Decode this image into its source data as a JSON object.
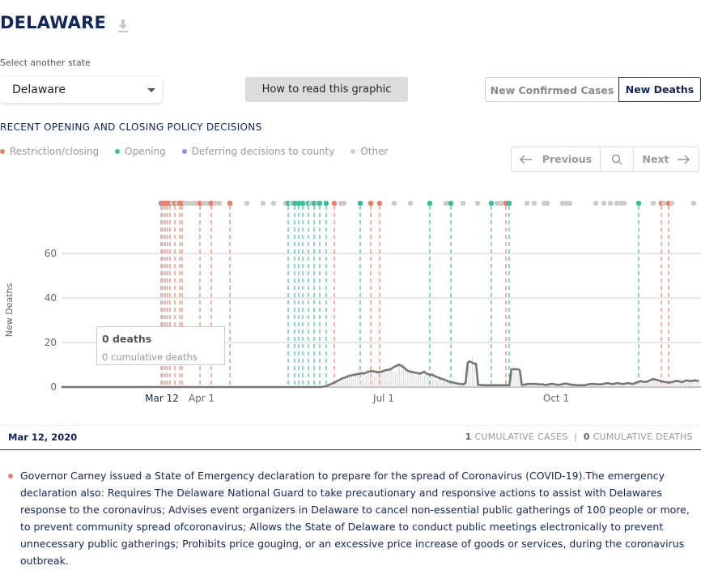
{
  "header": {
    "title": "DELAWARE",
    "download_icon": "download-icon"
  },
  "state_select": {
    "label": "Select another state",
    "value": "Delaware"
  },
  "how_to_button": "How to read this graphic",
  "metric_toggle": {
    "options": [
      "New Confirmed Cases",
      "New Deaths"
    ],
    "selected": "New Deaths"
  },
  "policy_section": {
    "title": "RECENT OPENING AND CLOSING POLICY DECISIONS",
    "legend": [
      {
        "label": "Restriction/closing",
        "color": "#e8806c"
      },
      {
        "label": "Opening",
        "color": "#3cbf9a"
      },
      {
        "label": "Deferring decisions to county",
        "color": "#8b93e8"
      },
      {
        "label": "Other",
        "color": "#cccccc"
      }
    ]
  },
  "nav": {
    "previous": "Previous",
    "next": "Next"
  },
  "chart_data": {
    "type": "bar",
    "ylabel": "New Deaths",
    "y_ticks": [
      "0",
      "20",
      "40",
      "60"
    ],
    "ylim": [
      0,
      75
    ],
    "x_ticks": [
      "Mar 12",
      "Apr 1",
      "Jul 1",
      "Oct 1"
    ],
    "highlight_tick": "Mar 12",
    "series": [
      {
        "type": "moving_average_line",
        "values": [
          0,
          0,
          0,
          0,
          0,
          0,
          0,
          0,
          0,
          0,
          0,
          0,
          0,
          0,
          0,
          0,
          0,
          0,
          0,
          0,
          0,
          0,
          0,
          0,
          0,
          0,
          0,
          0,
          0,
          0,
          0,
          0,
          0,
          0,
          0,
          0,
          0,
          0,
          0,
          0,
          0,
          0,
          0,
          0,
          0,
          0,
          0,
          0,
          0,
          0,
          0,
          0,
          0,
          0,
          0,
          0,
          0,
          0,
          0,
          0,
          0,
          0,
          0,
          0,
          0,
          0,
          0,
          0,
          0,
          0,
          0,
          0,
          0,
          0,
          0,
          0,
          0,
          0,
          0,
          0,
          0,
          0,
          0,
          0,
          0,
          0,
          0,
          0,
          0,
          0,
          0,
          0,
          0,
          0,
          0,
          0,
          0,
          0,
          0,
          0,
          0,
          0,
          0,
          0,
          0,
          0,
          0,
          0,
          0,
          0,
          0,
          0,
          0,
          0,
          0,
          0,
          0,
          0,
          0,
          0,
          0,
          0,
          0,
          0,
          0,
          0,
          0.2,
          0.4,
          0.8,
          1.2,
          1.6,
          2.0,
          2.5,
          3.0,
          3.5,
          4.0,
          4.2,
          4.6,
          5.0,
          5.2,
          5.4,
          5.6,
          5.8,
          6.0,
          6.2,
          6.0,
          6.4,
          6.8,
          7.0,
          7.2,
          7.0,
          6.8,
          6.6,
          6.8,
          7.0,
          7.4,
          7.6,
          7.8,
          8.0,
          8.6,
          9.2,
          9.6,
          10.0,
          9.6,
          9.0,
          8.2,
          7.4,
          7.0,
          6.8,
          6.6,
          6.4,
          6.2,
          6.0,
          6.4,
          6.8,
          6.2,
          5.8,
          5.4,
          5.6,
          5.0,
          4.6,
          4.2,
          3.8,
          3.6,
          3.2,
          2.8,
          2.4,
          2.2,
          2.0,
          1.8,
          1.6,
          1.4,
          1.4,
          1.2,
          2.0,
          11.0,
          11.5,
          11.0,
          10.5,
          10.5,
          1.0,
          1.0,
          0.8,
          0.8,
          0.8,
          0.8,
          0.8,
          0.8,
          0.8,
          0.8,
          0.8,
          0.8,
          0.8,
          0.8,
          0.8,
          0.8,
          8.0,
          8.0,
          8.0,
          8.0,
          7.5,
          1.0,
          1.0,
          1.2,
          1.4,
          1.4,
          1.4,
          1.4,
          1.4,
          1.2,
          1.2,
          1.2,
          1.0,
          1.0,
          1.2,
          1.4,
          1.4,
          1.2,
          1.0,
          1.0,
          1.2,
          1.4,
          1.6,
          1.4,
          1.2,
          1.0,
          1.0,
          0.8,
          0.8,
          0.8,
          0.8,
          0.8,
          1.0,
          1.2,
          1.4,
          1.4,
          1.4,
          1.2,
          1.2,
          1.2,
          1.4,
          1.6,
          1.8,
          1.6,
          1.4,
          1.4,
          1.6,
          1.8,
          1.6,
          1.4,
          1.4,
          1.6,
          1.8,
          1.6,
          1.4,
          1.6,
          2.0,
          2.4,
          2.6,
          2.4,
          2.2,
          2.4,
          2.8,
          3.2,
          3.6,
          3.4,
          3.2,
          2.8,
          2.6,
          2.4,
          2.2,
          2.0,
          2.0,
          2.2,
          2.4,
          2.8,
          2.6,
          2.4,
          2.2,
          2.6,
          3.0,
          2.8,
          2.6,
          2.8,
          3.0,
          2.8,
          2.6
        ]
      }
    ]
  },
  "policy_markers": {
    "colors": {
      "restriction": "#e8806c",
      "opening": "#3cbf9a",
      "county": "#8b93e8",
      "other": "#cccccc"
    }
  },
  "tooltip": {
    "title": "0 deaths",
    "subtitle": "0 cumulative deaths"
  },
  "footer": {
    "date": "Mar 12, 2020",
    "cases_count": "1",
    "cases_label": "CUMULATIVE CASES",
    "separator": "|",
    "deaths_count": "0",
    "deaths_label": "CUMULATIVE DEATHS"
  },
  "policy_detail": {
    "text": "Governor Carney issued a State of Emergency declaration to prepare for the spread of Coronavirus (COVID-19).The emergency declaration also: Requires The Delaware National Guard to take precautionary and responsive actions to assist with Delawares response to the coronavirus; Advises event organizers in Delaware to cancel non-essential public gatherings of 100 people or more, to prevent community spread ofcoronavirus; Allows the State of Delaware to conduct public meetings electronically to prevent unnecessary public gatherings; Prohibits price gouging, or an excessive price increase of goods or services, during the coronavirus outbreak."
  }
}
